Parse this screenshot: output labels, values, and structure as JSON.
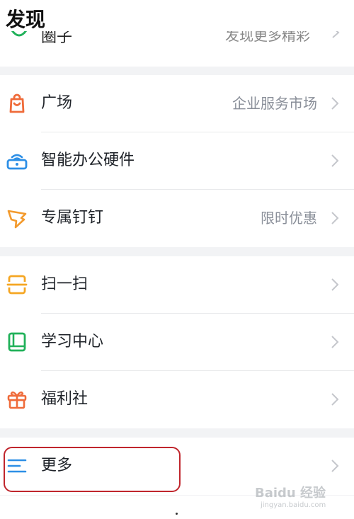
{
  "header": {
    "title": "发现"
  },
  "partial_row": {
    "label": "圈子",
    "right": "发现更多精彩"
  },
  "groups": [
    {
      "items": [
        {
          "label": "广场",
          "right": "企业服务市场",
          "icon": "shopping-bag-icon",
          "color": "#ef6b3a"
        },
        {
          "label": "智能办公硬件",
          "right": "",
          "icon": "office-device-icon",
          "color": "#2d8fe6"
        },
        {
          "label": "专属钉钉",
          "right": "限时优惠",
          "icon": "dingtalk-wing-icon",
          "color": "#f39a2d"
        }
      ]
    },
    {
      "items": [
        {
          "label": "扫一扫",
          "right": "",
          "icon": "scan-icon",
          "color": "#f5a623"
        },
        {
          "label": "学习中心",
          "right": "",
          "icon": "book-icon",
          "color": "#21b15a"
        },
        {
          "label": "福利社",
          "right": "",
          "icon": "gift-icon",
          "color": "#ef6b3a"
        }
      ]
    },
    {
      "items": [
        {
          "label": "更多",
          "right": "",
          "icon": "menu-lines-icon",
          "color": "#2d8fe6"
        }
      ]
    }
  ],
  "watermark": {
    "main": "Baidu 经验",
    "sub": "jingyan.baidu.com"
  }
}
